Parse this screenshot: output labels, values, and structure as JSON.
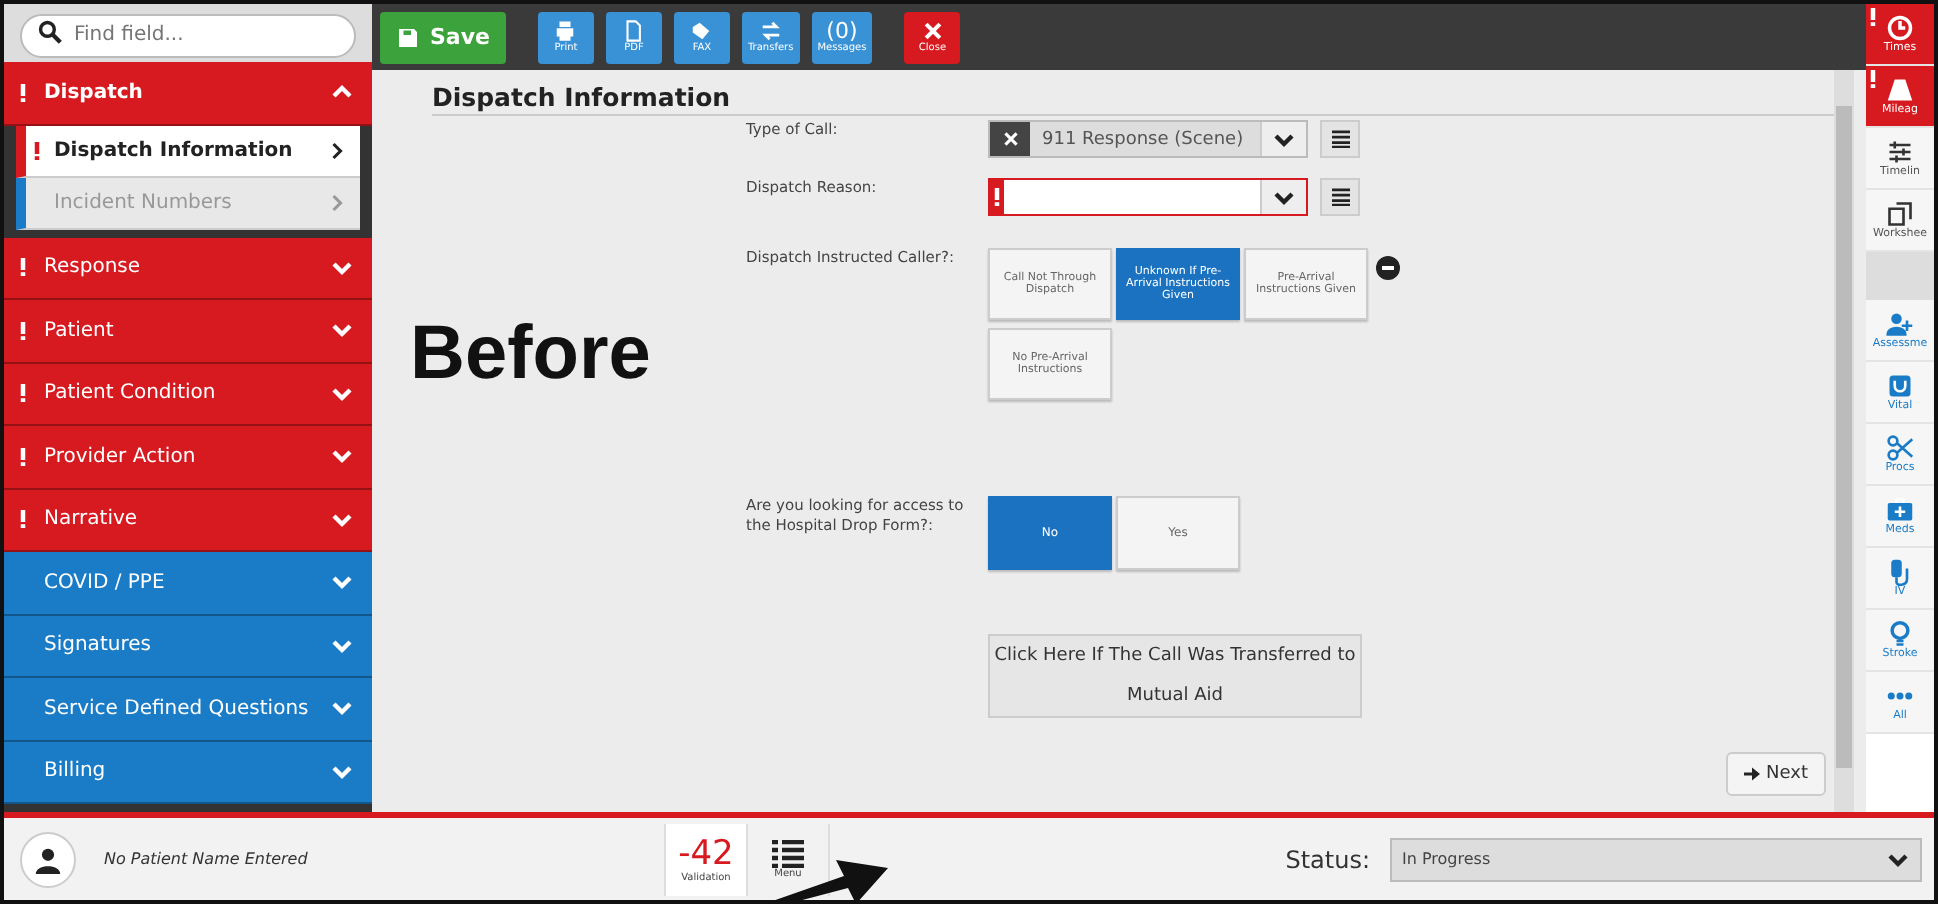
{
  "search": {
    "placeholder": "Find field..."
  },
  "sidebar": {
    "items": [
      {
        "label": "Dispatch",
        "alert": true,
        "color": "#d71920",
        "expanded": true,
        "children": [
          {
            "label": "Dispatch Information",
            "alert": true,
            "selected": true
          },
          {
            "label": "Incident Numbers",
            "alert": false,
            "selected": false
          }
        ]
      },
      {
        "label": "Response",
        "alert": true,
        "color": "#d71920",
        "expanded": false
      },
      {
        "label": "Patient",
        "alert": true,
        "color": "#d71920",
        "expanded": false
      },
      {
        "label": "Patient Condition",
        "alert": true,
        "color": "#d71920",
        "expanded": false
      },
      {
        "label": "Provider Action",
        "alert": true,
        "color": "#d71920",
        "expanded": false
      },
      {
        "label": "Narrative",
        "alert": true,
        "color": "#d71920",
        "expanded": false
      },
      {
        "label": "COVID / PPE",
        "alert": false,
        "color": "#1a7cc7",
        "expanded": false
      },
      {
        "label": "Signatures",
        "alert": false,
        "color": "#1a7cc7",
        "expanded": false
      },
      {
        "label": "Service Defined Questions",
        "alert": false,
        "color": "#1a7cc7",
        "expanded": false
      },
      {
        "label": "Billing",
        "alert": false,
        "color": "#1a7cc7",
        "expanded": false
      }
    ]
  },
  "toolbar": [
    {
      "kind": "save",
      "label": "Save"
    },
    {
      "kind": "print",
      "label": "Print"
    },
    {
      "kind": "pdf",
      "label": "PDF"
    },
    {
      "kind": "fax",
      "label": "FAX"
    },
    {
      "kind": "transfers",
      "label": "Transfers"
    },
    {
      "kind": "messages",
      "count": "(0)",
      "label": "Messages"
    },
    {
      "kind": "close",
      "label": "Close"
    }
  ],
  "form": {
    "title": "Dispatch Information",
    "fields": [
      {
        "kind": "select",
        "label": "Type of Call:",
        "value": "911 Response (Scene)",
        "required": false
      },
      {
        "kind": "select",
        "label": "Dispatch Reason:",
        "required": true
      },
      {
        "kind": "choice",
        "label": "Dispatch Instructed Caller?:",
        "options": [
          {
            "label": "Call Not Through Dispatch",
            "selected": false
          },
          {
            "label": "Unknown If Pre-Arrival Instructions Given",
            "selected": true
          },
          {
            "label": "Pre-Arrival Instructions Given",
            "selected": false
          },
          {
            "label": "No Pre-Arrival Instructions",
            "selected": false
          }
        ]
      },
      {
        "kind": "choice",
        "label": "Are you looking for access to the Hospital Drop Form?:",
        "options": [
          {
            "label": "No",
            "selected": true
          },
          {
            "label": "Yes",
            "selected": false
          }
        ]
      },
      {
        "kind": "button",
        "label": "Click Here If The Call Was Transferred to Mutual Aid"
      }
    ],
    "next": "Next"
  },
  "rail": [
    {
      "kind": "times",
      "label": "Times",
      "alert": true
    },
    {
      "kind": "mileage",
      "label": "Mileag",
      "alert": true
    },
    {
      "kind": "timeline",
      "label": "Timelin",
      "alert": false
    },
    {
      "kind": "worksheet",
      "label": "Workshee",
      "alert": false
    },
    {
      "kind": "gap"
    },
    {
      "kind": "assessment",
      "label": "Assessme",
      "alert": false
    },
    {
      "kind": "vital",
      "label": "Vital",
      "alert": false
    },
    {
      "kind": "procs",
      "label": "Procs",
      "alert": false
    },
    {
      "kind": "meds",
      "label": "Meds",
      "alert": false
    },
    {
      "kind": "iv",
      "label": "IV",
      "alert": false
    },
    {
      "kind": "stroke",
      "label": "Stroke",
      "alert": false
    },
    {
      "kind": "all",
      "label": "All",
      "alert": false
    }
  ],
  "footer": {
    "patient": "No Patient Name Entered",
    "validation_count": "-42",
    "validation_label": "Validation",
    "menu_label": "Menu",
    "status_label": "Status:",
    "status_value": "In Progress"
  },
  "annotation": {
    "text": "Before"
  }
}
